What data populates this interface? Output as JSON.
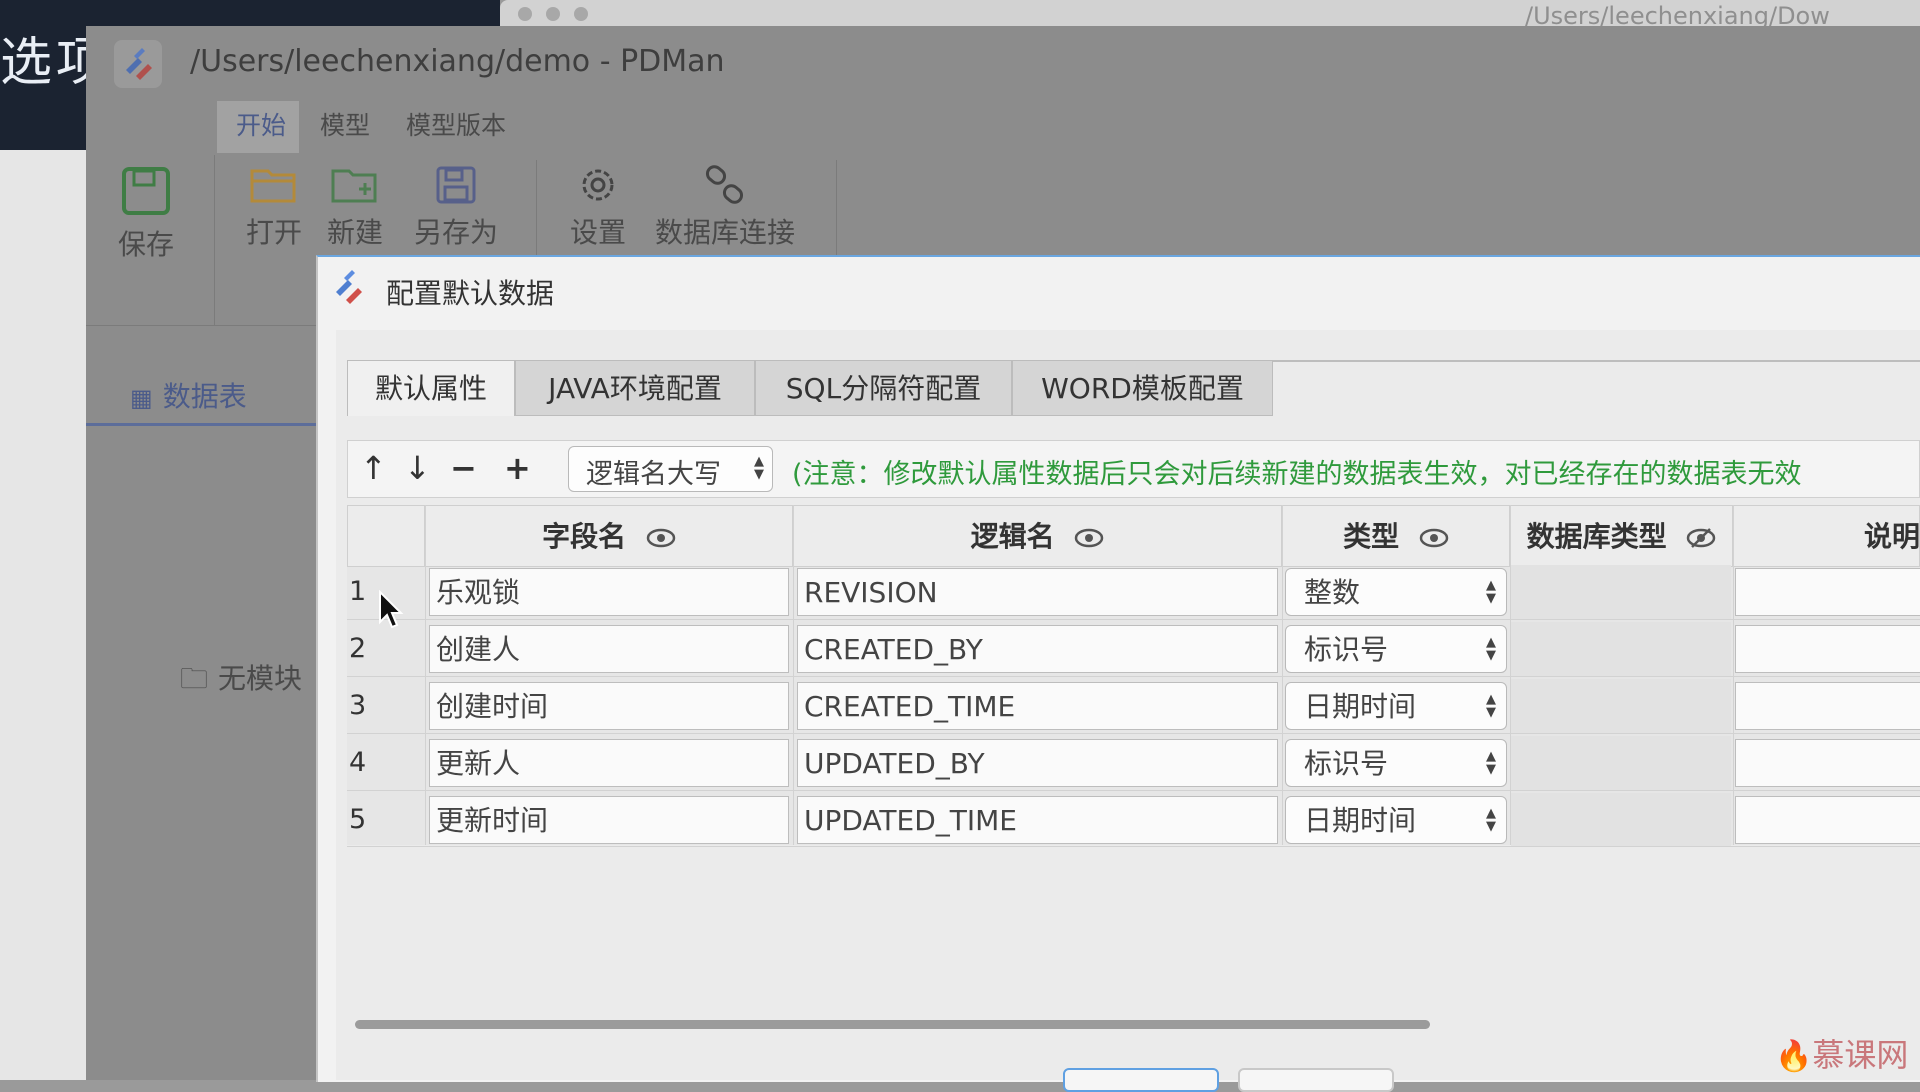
{
  "background": {
    "left_title": "选项目",
    "second_window_path": "/Users/leechenxiang/Dow"
  },
  "app": {
    "title": "/Users/leechenxiang/demo - PDMan",
    "menu": [
      "开始",
      "模型",
      "模型版本"
    ],
    "ribbon": {
      "save": "保存",
      "open": "打开",
      "new": "新建",
      "save_as": "另存为",
      "settings": "设置",
      "db_connect": "数据库连接"
    },
    "sidebar": {
      "tab_label": "数据表",
      "empty_text": "无模块"
    }
  },
  "dialog": {
    "title": "配置默认数据",
    "tabs": [
      "默认属性",
      "JAVA环境配置",
      "SQL分隔符配置",
      "WORD模板配置"
    ],
    "active_tab": 0,
    "toolbar": {
      "up": "↑",
      "down": "↓",
      "remove": "−",
      "add": "+",
      "case_select": "逻辑名大写",
      "notice": "(注意：修改默认属性数据后只会对后续新建的数据表生效，对已经存在的数据表无效"
    },
    "table": {
      "headers": [
        "字段名",
        "逻辑名",
        "类型",
        "数据库类型",
        "说明"
      ],
      "rows": [
        {
          "index": "1",
          "name": "乐观锁",
          "logic": "REVISION",
          "type": "整数"
        },
        {
          "index": "2",
          "name": "创建人",
          "logic": "CREATED_BY",
          "type": "标识号"
        },
        {
          "index": "3",
          "name": "创建时间",
          "logic": "CREATED_TIME",
          "type": "日期时间"
        },
        {
          "index": "4",
          "name": "更新人",
          "logic": "UPDATED_BY",
          "type": "标识号"
        },
        {
          "index": "5",
          "name": "更新时间",
          "logic": "UPDATED_TIME",
          "type": "日期时间"
        }
      ]
    }
  },
  "watermark": "慕课网",
  "colors": {
    "notice": "#2f9a3c",
    "accent": "#5fa0e2",
    "sidebar_tab": "#4b5b8a"
  }
}
